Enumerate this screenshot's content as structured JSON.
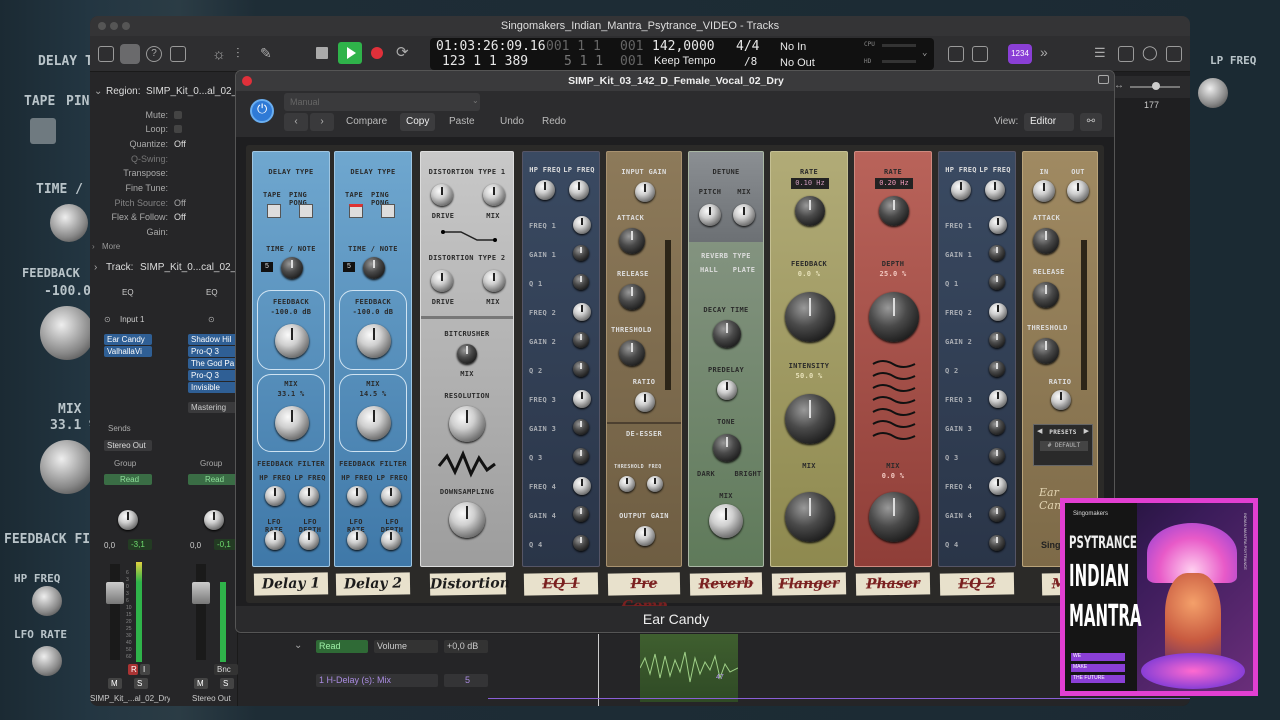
{
  "window_title": "Singomakers_Indian_Mantra_Psytrance_VIDEO - Tracks",
  "lcd": {
    "position_time": "01:03:26:09.16",
    "position_bars_dim": "001 1 1",
    "position_bars_dim2": "001",
    "position_bars": "123 1 1 389",
    "position_bars2_dim": "5 1 1",
    "position_bars2_dim2": "001",
    "tempo": "142,0000",
    "tempo_mode": "Keep Tempo",
    "time_sig": "4/4",
    "division": "/8",
    "in": "No In",
    "out": "No Out",
    "cpu": "CPU",
    "hd": "HD"
  },
  "toolbar": {
    "badge": "1234",
    "ruler_value": "177"
  },
  "inspector": {
    "region_label": "Region:",
    "region_name": "SIMP_Kit_0...al_02_D",
    "props": [
      {
        "label": "Mute:",
        "value": ""
      },
      {
        "label": "Loop:",
        "value": ""
      },
      {
        "label": "Quantize:",
        "value": "Off"
      },
      {
        "label": "Q-Swing:",
        "value": ""
      },
      {
        "label": "Transpose:",
        "value": ""
      },
      {
        "label": "Fine Tune:",
        "value": ""
      },
      {
        "label": "Pitch Source:",
        "value": "Off"
      },
      {
        "label": "Flex & Follow:",
        "value": "Off"
      },
      {
        "label": "Gain:",
        "value": ""
      }
    ],
    "more": "More",
    "track_label": "Track:",
    "track_name": "SIMP_Kit_0...cal_02_D",
    "strip1": {
      "eq": "EQ",
      "input": "Input 1",
      "plugins": [
        "Ear Candy",
        "ValhallaVi"
      ],
      "sends": "Sends",
      "output": "Stereo Out",
      "group": "Group",
      "auto": "Read",
      "vol": "0,0",
      "peak": "-3,1",
      "name": "SIMP_Kit_...al_02_Dry",
      "r": "R",
      "i": "I",
      "m": "M",
      "s": "S"
    },
    "strip2": {
      "eq": "EQ",
      "plugins": [
        "Shadow Hil",
        "Pro-Q 3",
        "The God Pa",
        "Pro-Q 3",
        "Invisible"
      ],
      "mastering": "Mastering",
      "group": "Group",
      "auto": "Read",
      "vol": "0,0",
      "peak": "-0,1",
      "bnc": "Bnc",
      "name": "Stereo Out",
      "m": "M",
      "s": "S"
    },
    "fader_scale": [
      "6",
      "3",
      "0",
      "3",
      "6",
      "10",
      "15",
      "20",
      "25",
      "30",
      "40",
      "50",
      "60"
    ]
  },
  "tracks": {
    "auto_mode": "Read",
    "auto_param": "Volume",
    "auto_value": "+0,0 dB",
    "lane_param": "1 H-Delay (s): Mix",
    "lane_value": "5",
    "point_value": "47"
  },
  "plugin": {
    "title": "SIMP_Kit_03_142_D_Female_Vocal_02_Dry",
    "preset": "Manual",
    "compare": "Compare",
    "copy": "Copy",
    "paste": "Paste",
    "undo": "Undo",
    "redo": "Redo",
    "view_label": "View:",
    "view_value": "Editor",
    "footer": "Ear Candy",
    "delay1": {
      "type": "DELAY TYPE",
      "tape": "TAPE",
      "ping": "PING PONG",
      "time": "TIME / NOTE",
      "note": "5",
      "feedback": "FEEDBACK",
      "feedback_val": "-100.0 dB",
      "mix": "MIX",
      "mix_val": "33.1 %",
      "filter": "FEEDBACK FILTER",
      "hp": "HP FREQ",
      "lp": "LP FREQ",
      "lfo_rate": "LFO RATE",
      "lfo_depth": "LFO DEPTH"
    },
    "delay2": {
      "type": "DELAY TYPE",
      "tape": "TAPE",
      "ping": "PING PONG",
      "time": "TIME / NOTE",
      "note": "5",
      "feedback": "FEEDBACK",
      "feedback_val": "-100.0 dB",
      "mix": "MIX",
      "mix_val": "14.5 %",
      "filter": "FEEDBACK FILTER",
      "hp": "HP FREQ",
      "lp": "LP FREQ",
      "lfo_rate": "LFO RATE",
      "lfo_depth": "LFO DEPTH"
    },
    "distortion": {
      "type1": "DISTORTION TYPE 1",
      "drive": "DRIVE",
      "mix": "MIX",
      "type2": "DISTORTION TYPE 2",
      "bitcrusher": "BITCRUSHER",
      "bc_mix": "MIX",
      "resolution": "RESOLUTION",
      "downsampling": "DOWNSAMPLING"
    },
    "eq1": {
      "hp": "HP FREQ",
      "lp": "LP FREQ",
      "bands": [
        "FREQ 1",
        "GAIN 1",
        "Q 1",
        "FREQ 2",
        "GAIN 2",
        "Q 2",
        "FREQ 3",
        "GAIN 3",
        "Q 3",
        "FREQ 4",
        "GAIN 4",
        "Q 4"
      ]
    },
    "comp": {
      "input": "INPUT GAIN",
      "attack": "ATTACK",
      "release": "RELEASE",
      "threshold": "THRESHOLD",
      "ratio": "RATIO",
      "deesser": "DE-ESSER",
      "thr": "THRESHOLD",
      "freq": "FREQ",
      "output": "OUTPUT GAIN"
    },
    "reverb": {
      "detune": "DETUNE",
      "pitch": "PITCH",
      "mix": "MIX",
      "type": "REVERB TYPE",
      "hall": "HALL",
      "plate": "PLATE",
      "decay": "DECAY TIME",
      "predelay": "PREDELAY",
      "tone": "TONE",
      "dark": "DARK",
      "bright": "BRIGHT",
      "mix2": "MIX"
    },
    "flanger": {
      "rate": "RATE",
      "rate_val": "0.10 Hz",
      "feedback": "FEEDBACK",
      "feedback_val": "0.0 %",
      "intensity": "INTENSITY",
      "intensity_val": "50.0 %",
      "mix": "MIX"
    },
    "phaser": {
      "rate": "RATE",
      "rate_val": "0.20 Hz",
      "depth": "DEPTH",
      "depth_val": "25.0 %",
      "mix": "MIX",
      "mix_val": "0.0 %"
    },
    "eq2": {
      "hp": "HP FREQ",
      "lp": "LP FREQ",
      "bands": [
        "FREQ 1",
        "GAIN 1",
        "Q 1",
        "FREQ 2",
        "GAIN 2",
        "Q 2",
        "FREQ 3",
        "GAIN 3",
        "Q 3",
        "FREQ 4",
        "GAIN 4",
        "Q 4"
      ]
    },
    "master": {
      "in": "IN",
      "out": "OUT",
      "attack": "ATTACK",
      "release": "RELEASE",
      "threshold": "THRESHOLD",
      "ratio": "RATIO",
      "presets": "PRESETS",
      "preset_val": "# DEFAULT",
      "logo": "Ear Candy",
      "brand": "Singom"
    },
    "tabs": [
      "Delay 1",
      "Delay 2",
      "Distortion",
      "EQ 1",
      "Pre Comp",
      "Reverb",
      "Flanger",
      "Phaser",
      "EQ 2",
      "MAS"
    ]
  },
  "background": {
    "delay_time": "DELAY TI",
    "tape": "TAPE",
    "ping": "PIN",
    "time_note": "TIME / NO",
    "feedback": "FEEDBACK",
    "feedback_val": "-100.0",
    "mix": "MIX",
    "mix_val": "33.1 %",
    "feedback_filter": "FEEDBACK FI",
    "hp_freq": "HP FREQ",
    "lfo_rate": "LFO RATE",
    "lp_freq_r": "LP FREQ"
  },
  "album": {
    "brand": "Singomakers",
    "line1": "PSYTRANCE",
    "line2": "INDIAN",
    "line3": "MANTRA",
    "tag1": "WE",
    "tag2": "MAKE",
    "tag3": "THE FUTURE",
    "side": "INDIAN MANTRA PSYTRANCE"
  },
  "colors": {
    "accent_purple": "#8a3fd6",
    "play_green": "#2fb34a",
    "record_red": "#e0303a",
    "delay_blue": "#4e86b4",
    "album_pink": "#e23fd2"
  }
}
